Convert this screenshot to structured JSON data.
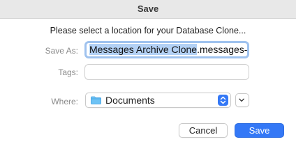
{
  "dialog": {
    "title": "Save",
    "prompt": "Please select a location for your Database Clone..."
  },
  "fields": {
    "save_as_label": "Save As:",
    "save_as_selected": "Messages Archive Clone",
    "save_as_rest": ".messages-",
    "tags_label": "Tags:",
    "tags_value": "",
    "where_label": "Where:",
    "where_value": "Documents"
  },
  "icons": {
    "folder": "folder-icon",
    "stepper": "up-down-chevron-icon",
    "expand": "chevron-down-icon"
  },
  "buttons": {
    "cancel": "Cancel",
    "save": "Save"
  },
  "colors": {
    "accent": "#3478f6",
    "selection": "#b3d1f5",
    "focus_ring": "#9fc2ee"
  }
}
